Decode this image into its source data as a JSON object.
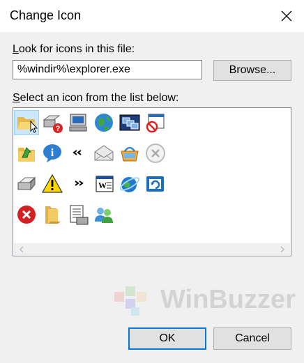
{
  "window": {
    "title": "Change Icon"
  },
  "file_label": "Look for icons in this file:",
  "file_label_accel": "L",
  "file_label_rest": "ook for icons in this file:",
  "path_value": "%windir%\\explorer.exe",
  "browse_label": "Browse...",
  "list_label_accel": "S",
  "list_label_rest": "elect an icon from the list below:",
  "icons": [
    "folder-open-icon",
    "printer-help-icon",
    "computer-icon",
    "globe-icon",
    "windows-cascade-icon",
    "no-entry-window-icon",
    "folder-up-arrow-icon",
    "info-icon",
    "double-left-chevron-icon",
    "mail-icon",
    "shopping-basket-icon",
    "close-circle-icon",
    "printer-icon",
    "warning-icon",
    "double-right-chevron-icon",
    "word-document-icon",
    "ie-globe-icon",
    "restore-window-icon",
    "error-x-icon",
    "folder-closed-icon",
    "document-list-icon",
    "users-icon"
  ],
  "selected_icon_index": 0,
  "ok_label": "OK",
  "cancel_label": "Cancel",
  "watermark_text": "WinBuzzer",
  "colors": {
    "accent": "#0078d7",
    "selection": "#cce8ff"
  }
}
